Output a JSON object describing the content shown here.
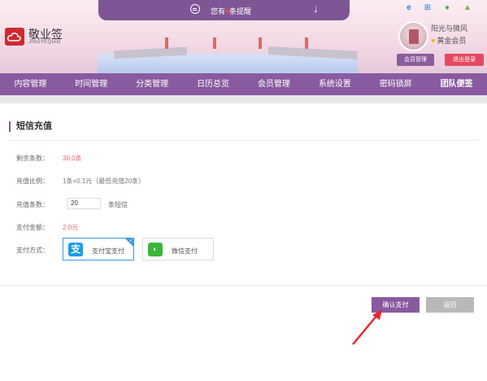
{
  "header": {
    "notice_prefix": "您有",
    "notice_count": "0",
    "notice_suffix": "条提醒",
    "brand_name": "敬业签",
    "brand_sub": "JINGYEQIAN",
    "user_name": "阳光与微风",
    "user_level": "黄金会员",
    "member_btn": "会员管理",
    "logout_btn": "退出登录",
    "platform_icons": [
      "ie-icon",
      "windows-icon",
      "apple-icon",
      "android-icon"
    ]
  },
  "nav": {
    "items": [
      "内容管理",
      "时间管理",
      "分类管理",
      "日历总览",
      "会员管理",
      "系统设置",
      "密码锁屏",
      "团队便签"
    ]
  },
  "section": {
    "title": "短信充值"
  },
  "form": {
    "remaining_label": "剩余条数：",
    "remaining_value": "30.0条",
    "ratio_label": "充值比例：",
    "ratio_value": "1条=0.1元（最低充值20条）",
    "count_label": "充值条数：",
    "count_value": "20",
    "count_unit": "条短信",
    "amount_label": "支付金额：",
    "amount_value": "2.0元",
    "method_label": "支付方式：",
    "alipay_label": "支付宝支付",
    "wechat_label": "微信支付"
  },
  "actions": {
    "confirm": "确认支付",
    "back": "返回"
  },
  "colors": {
    "accent": "#8a5aa0",
    "danger": "#e84962",
    "alipay": "#1a9be8",
    "wechat": "#3ab63a"
  }
}
